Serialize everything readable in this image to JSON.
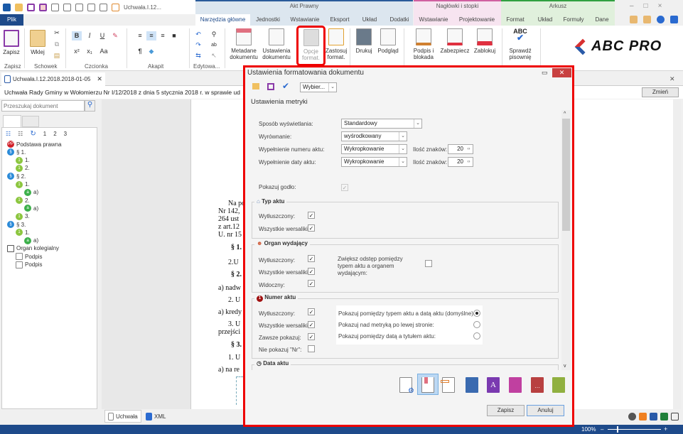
{
  "quick_access": {
    "doc_title": "Uchwała.I.12..."
  },
  "file_tab": "Plik",
  "contextual_groups": [
    {
      "label": "Akt Prawny",
      "color": "#dce6ef"
    },
    {
      "label": "Nagłówki i stopki",
      "color": "#f7e4f0"
    },
    {
      "label": "Arkusz",
      "color": "#e0f0dc"
    }
  ],
  "tabs": [
    "Narzędzia główne",
    "Jednostki",
    "Wstawianie",
    "Eksport",
    "Układ",
    "Dodatki",
    "Wstawianie",
    "Projektowanie",
    "Format",
    "Układ",
    "Formuły",
    "Dane"
  ],
  "ribbon": {
    "buttons": {
      "zapisz": "Zapisz",
      "wklej": "Wklej",
      "metadane": "Metadane dokumentu",
      "ustawienia": "Ustawienia dokumentu",
      "opcje": "Opcje format.",
      "zastosuj": "Zastosuj format.",
      "drukuj": "Drukuj",
      "podglad": "Podgląd",
      "podpis": "Podpis i blokada",
      "zabezpiecz": "Zabezpiecz",
      "zablokuj": "Zablokuj",
      "sprawdz": "Sprawdź pisownię"
    },
    "groups": [
      "Zapisz",
      "Schowek",
      "Czcionka",
      "Akapit",
      "Edytowa..."
    ],
    "font_buttons": [
      "B",
      "I",
      "U",
      "x²",
      "x₁",
      "Aa"
    ],
    "logo": "ABC PRO"
  },
  "doc_tab": {
    "title": "Uchwała.I.12.2018.2018-01-05"
  },
  "doc_heading": "Uchwała Rady Gminy w Wołomierzu Nr I/12/2018 z dnia 5 stycznia 2018 r. w sprawie ud",
  "change_button": "Zmień",
  "search": {
    "placeholder": "Przeszukaj dokument"
  },
  "tree_levels": [
    "1",
    "2",
    "3"
  ],
  "tree": [
    {
      "label": "Podstawa prawna",
      "badge": "PP",
      "color": "#d0202a",
      "indent": 0
    },
    {
      "label": "§ 1.",
      "badge": "§",
      "color": "#2a8ad8",
      "indent": 0
    },
    {
      "label": "1.",
      "badge": "1",
      "color": "#8cc63f",
      "indent": 1
    },
    {
      "label": "2.",
      "badge": "1",
      "color": "#8cc63f",
      "indent": 1
    },
    {
      "label": "§ 2.",
      "badge": "§",
      "color": "#2a8ad8",
      "indent": 0
    },
    {
      "label": "1.",
      "badge": "1",
      "color": "#8cc63f",
      "indent": 1
    },
    {
      "label": "a)",
      "badge": "a",
      "color": "#3cb04a",
      "indent": 2
    },
    {
      "label": "2.",
      "badge": "1",
      "color": "#8cc63f",
      "indent": 1
    },
    {
      "label": "a)",
      "badge": "a",
      "color": "#3cb04a",
      "indent": 2
    },
    {
      "label": "3.",
      "badge": "1",
      "color": "#8cc63f",
      "indent": 1
    },
    {
      "label": "§ 3.",
      "badge": "§",
      "color": "#2a8ad8",
      "indent": 0
    },
    {
      "label": "1.",
      "badge": "1",
      "color": "#8cc63f",
      "indent": 1
    },
    {
      "label": "a)",
      "badge": "a",
      "color": "#3cb04a",
      "indent": 2
    },
    {
      "label": "Organ kolegialny",
      "badge": "",
      "color": "#555555",
      "indent": 0
    },
    {
      "label": "Podpis",
      "badge": "",
      "color": "#888888",
      "indent": 1
    },
    {
      "label": "Podpis",
      "badge": "",
      "color": "#888888",
      "indent": 1
    }
  ],
  "document_lines": [
    "Na po",
    "Nr 142,",
    "264 ust",
    "z art.12",
    "U. nr 15",
    "§ 1.",
    "2.U",
    "§ 2.",
    "a) nadw",
    "2. U",
    "a) kredy",
    "3. U",
    "przejści",
    "§ 3.",
    "1. U",
    "a) na re"
  ],
  "bottom_tabs": [
    "Uchwała",
    "XML"
  ],
  "status": {
    "zoom": "100%"
  },
  "dialog": {
    "title": "Ustawienia formatowania dokumentu",
    "preset": "Wybier...",
    "section": "Ustawienia metryki",
    "fields": {
      "display_label": "Sposób wyświetlania:",
      "display_value": "Standardowy",
      "align_label": "Wyrównanie:",
      "align_value": "wyśrodkowany",
      "num_fill_label": "Wypełnienie numeru aktu:",
      "num_fill_value": "Wykropkowanie",
      "date_fill_label": "Wypełnienie daty aktu:",
      "date_fill_value": "Wykropkowanie",
      "chars_label": "Ilość znaków:",
      "num_chars": "20",
      "date_chars": "20",
      "emblem_label": "Pokazuj godło:"
    },
    "typ_aktu": {
      "title": "Typ aktu",
      "bold": "Wytłuszczony:",
      "caps": "Wszystkie wersaliki:",
      "bold_checked": true,
      "caps_checked": true
    },
    "organ": {
      "title": "Organ wydający",
      "bold": "Wytłuszczony:",
      "caps": "Wszystkie wersaliki:",
      "visible": "Widoczny:",
      "spacing": "Zwiększ odstęp pomiędzy typem aktu a organem wydającym:",
      "spacing_checked": false
    },
    "numer": {
      "title": "Numer aktu",
      "bold": "Wytłuszczony:",
      "caps": "Wszystkie wersaliki:",
      "always": "Zawsze pokazuj:",
      "no_nr": "Nie pokazuj \"Nr\":",
      "positions": [
        "Pokazuj pomiędzy typem aktu a datą aktu (domyślne):",
        "Pokazuj nad metryką po lewej stronie:",
        "Pokazuj pomiędzy datą a tytułem aktu:"
      ],
      "selected_position": 0
    },
    "data_aktu": {
      "title": "Data aktu"
    },
    "save": "Zapisz",
    "cancel": "Anuluj"
  }
}
